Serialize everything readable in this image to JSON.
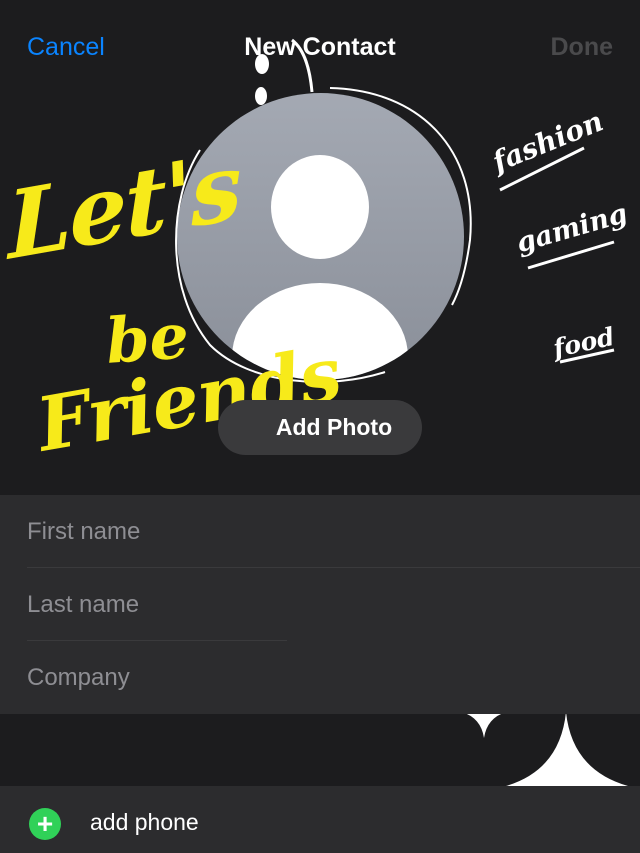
{
  "nav": {
    "cancel_label": "Cancel",
    "title": "New Contact",
    "done_label": "Done"
  },
  "avatar": {
    "add_photo_label": "Add Photo"
  },
  "stickers": {
    "line1": "Let's",
    "line2": "be",
    "line3": "Friends",
    "tags": [
      "fashion",
      "gaming",
      "food"
    ]
  },
  "form": {
    "first_name_placeholder": "First name",
    "last_name_placeholder": "Last name",
    "company_placeholder": "Company"
  },
  "phone": {
    "label": "add phone"
  },
  "colors": {
    "accent": "#0a84ff",
    "sticker_yellow": "#f7ea1a",
    "add_green": "#30d158",
    "background": "#1c1c1e",
    "field_background": "#2c2c2e"
  }
}
